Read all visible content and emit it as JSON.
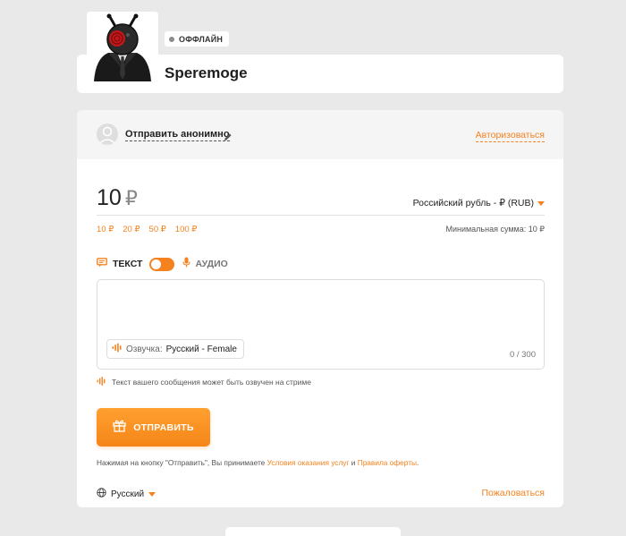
{
  "streamer": {
    "name": "Speremoge",
    "status": "ОФФЛАЙН"
  },
  "sender": {
    "anonymous_label": "Отправить анонимно",
    "login_label": "Авторизоваться"
  },
  "amount": {
    "value": "10",
    "currency_symbol": "₽",
    "currency_select": "Российский рубль - ₽ (RUB)",
    "presets": [
      "10 ₽",
      "20 ₽",
      "50 ₽",
      "100 ₽"
    ],
    "min_sum": "Минимальная сумма: 10 ₽"
  },
  "mode": {
    "text_label": "ТЕКСТ",
    "audio_label": "АУДИО",
    "selected": "text"
  },
  "message": {
    "value": "",
    "voice_label": "Озвучка:",
    "voice_value": "Русский - Female",
    "counter": "0 / 300",
    "hint": "Текст вашего сообщения может быть озвучен на стриме"
  },
  "send": {
    "label": "ОТПРАВИТЬ"
  },
  "terms": {
    "prefix": "Нажимая на кнопку \"Отправить\", Вы принимаете",
    "link1": "Условия оказания услуг",
    "middle": "и",
    "link2": "Правила оферты",
    "suffix": "."
  },
  "footer": {
    "language": "Русский",
    "report": "Пожаловаться"
  },
  "colors": {
    "accent": "#f5821f",
    "page_bg": "#e9e9e9",
    "card_bg": "#ffffff",
    "status_dot": "#8c8c8c"
  },
  "icons": {
    "pencil": "pencil-icon",
    "text_mode": "chat-icon",
    "audio_mode": "microphone-icon",
    "voice": "sound-wave-icon",
    "send": "gift-icon",
    "language": "globe-icon",
    "currency_caret": "chevron-down-icon"
  }
}
